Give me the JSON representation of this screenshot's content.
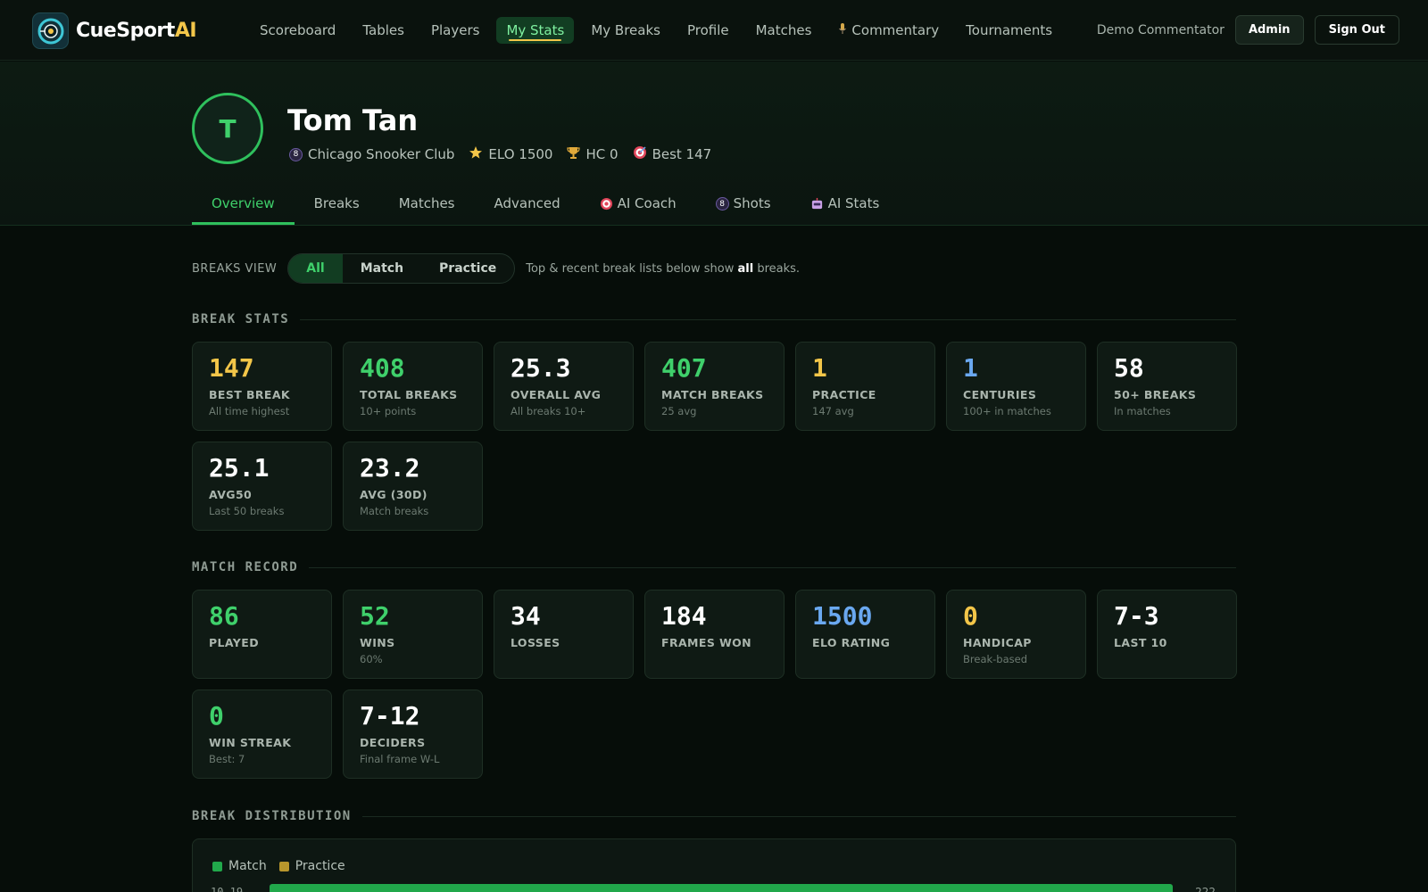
{
  "app": {
    "brand_main": "CueSport",
    "brand_ai": "AI",
    "accent": "#3fd06b",
    "gold": "#f3c649",
    "blue": "#6aa8f0"
  },
  "nav": {
    "items": [
      {
        "label": "Scoreboard"
      },
      {
        "label": "Tables"
      },
      {
        "label": "Players"
      },
      {
        "label": "My Stats",
        "active": true
      },
      {
        "label": "My Breaks"
      },
      {
        "label": "Profile"
      },
      {
        "label": "Matches"
      },
      {
        "label": "Commentary",
        "icon": "microphone-icon"
      },
      {
        "label": "Tournaments"
      }
    ],
    "user": "Demo Commentator",
    "admin_label": "Admin",
    "signout_label": "Sign Out"
  },
  "profile": {
    "initial": "T",
    "name": "Tom Tan",
    "club": "Chicago Snooker Club",
    "elo": "ELO 1500",
    "hc": "HC 0",
    "best": "Best 147"
  },
  "tabs": [
    {
      "label": "Overview",
      "active": true
    },
    {
      "label": "Breaks"
    },
    {
      "label": "Matches"
    },
    {
      "label": "Advanced"
    },
    {
      "label": "AI Coach",
      "icon": "target-icon"
    },
    {
      "label": "Shots",
      "icon": "eight-ball-icon"
    },
    {
      "label": "AI Stats",
      "icon": "robot-icon"
    }
  ],
  "breaks_view": {
    "label": "BREAKS VIEW",
    "options": [
      "All",
      "Match",
      "Practice"
    ],
    "selected": "All",
    "note_pre": "Top & recent break lists below show ",
    "note_bold": "all",
    "note_post": " breaks."
  },
  "break_stats": {
    "title": "BREAK STATS",
    "cards": [
      {
        "value": "147",
        "label": "BEST BREAK",
        "sub": "All time highest",
        "color": "gold"
      },
      {
        "value": "408",
        "label": "TOTAL BREAKS",
        "sub": "10+ points",
        "color": "green"
      },
      {
        "value": "25.3",
        "label": "OVERALL AVG",
        "sub": "All breaks 10+",
        "color": "white"
      },
      {
        "value": "407",
        "label": "MATCH BREAKS",
        "sub": "25 avg",
        "color": "green"
      },
      {
        "value": "1",
        "label": "PRACTICE",
        "sub": "147 avg",
        "color": "gold"
      },
      {
        "value": "1",
        "label": "CENTURIES",
        "sub": "100+ in matches",
        "color": "blue"
      },
      {
        "value": "58",
        "label": "50+ BREAKS",
        "sub": "In matches",
        "color": "white"
      },
      {
        "value": "25.1",
        "label": "AVG50",
        "sub": "Last 50 breaks",
        "color": "white"
      },
      {
        "value": "23.2",
        "label": "AVG (30D)",
        "sub": "Match breaks",
        "color": "white"
      }
    ]
  },
  "match_record": {
    "title": "MATCH RECORD",
    "cards": [
      {
        "value": "86",
        "label": "PLAYED",
        "sub": "",
        "color": "green"
      },
      {
        "value": "52",
        "label": "WINS",
        "sub": "60%",
        "color": "green"
      },
      {
        "value": "34",
        "label": "LOSSES",
        "sub": "",
        "color": "white"
      },
      {
        "value": "184",
        "label": "FRAMES WON",
        "sub": "",
        "color": "white"
      },
      {
        "value": "1500",
        "label": "ELO RATING",
        "sub": "",
        "color": "blue"
      },
      {
        "value": "0",
        "label": "HANDICAP",
        "sub": "Break-based",
        "color": "gold"
      },
      {
        "value": "7-3",
        "label": "LAST 10",
        "sub": "",
        "color": "white"
      },
      {
        "value": "0",
        "label": "WIN STREAK",
        "sub": "Best: 7",
        "color": "green"
      },
      {
        "value": "7-12",
        "label": "DECIDERS",
        "sub": "Final frame W-L",
        "color": "white"
      }
    ]
  },
  "distribution": {
    "title": "BREAK DISTRIBUTION",
    "legend": [
      {
        "label": "Match",
        "color": "#21a84b"
      },
      {
        "label": "Practice",
        "color": "#b8962c"
      }
    ],
    "first_row": {
      "label": "10-19",
      "fraction": 1.0,
      "count": "222"
    }
  }
}
